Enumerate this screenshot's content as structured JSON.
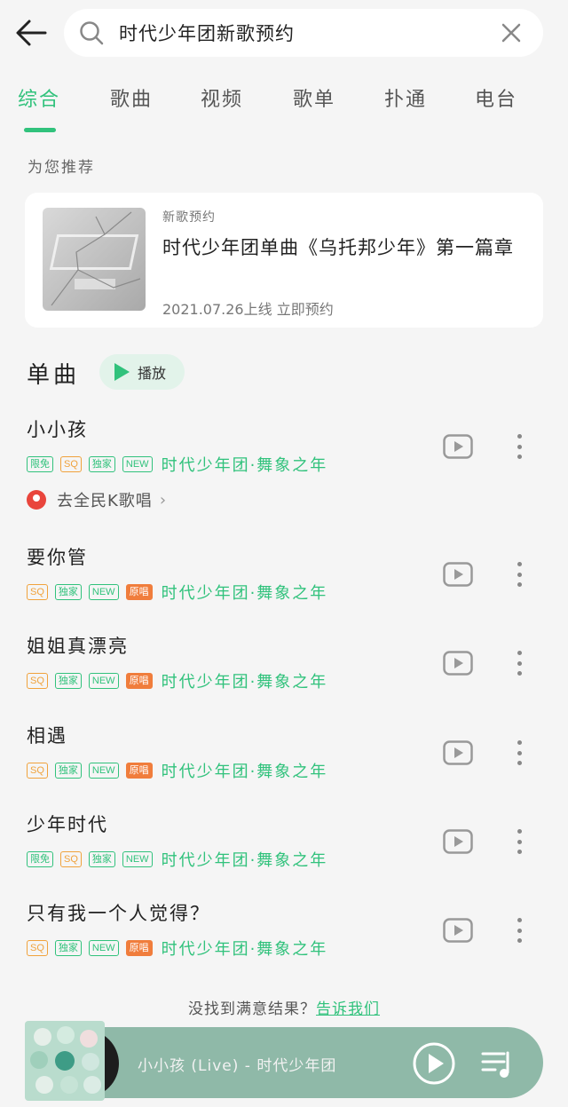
{
  "search": {
    "query": "时代少年团新歌预约"
  },
  "tabs": [
    {
      "label": "综合",
      "active": true
    },
    {
      "label": "歌曲"
    },
    {
      "label": "视频"
    },
    {
      "label": "歌单"
    },
    {
      "label": "扑通"
    },
    {
      "label": "电台"
    }
  ],
  "recommend": {
    "section_label": "为您推荐",
    "tag": "新歌预约",
    "title": "时代少年团单曲《乌托邦少年》第一篇章",
    "subtitle": "2021.07.26上线 立即预约"
  },
  "singles": {
    "title": "单曲",
    "play_all_label": "播放",
    "ksong_link": "去全民K歌唱",
    "songs": [
      {
        "title": "小小孩",
        "badges": [
          "限免",
          "SQ",
          "独家",
          "NEW"
        ],
        "artist": "时代少年团·舞象之年"
      },
      {
        "title": "要你管",
        "badges": [
          "SQ",
          "独家",
          "NEW",
          "原唱"
        ],
        "artist": "时代少年团·舞象之年"
      },
      {
        "title": "姐姐真漂亮",
        "badges": [
          "SQ",
          "独家",
          "NEW",
          "原唱"
        ],
        "artist": "时代少年团·舞象之年"
      },
      {
        "title": "相遇",
        "badges": [
          "SQ",
          "独家",
          "NEW",
          "原唱"
        ],
        "artist": "时代少年团·舞象之年"
      },
      {
        "title": "少年时代",
        "badges": [
          "限免",
          "SQ",
          "独家",
          "NEW"
        ],
        "artist": "时代少年团·舞象之年"
      },
      {
        "title": "只有我一个人觉得？",
        "badges": [
          "SQ",
          "独家",
          "NEW",
          "原唱"
        ],
        "artist": "时代少年团·舞象之年"
      }
    ]
  },
  "feedback": {
    "text": "没找到满意结果？",
    "link": "告诉我们"
  },
  "player": {
    "now_playing": "小小孩 (Live) - 时代少年团"
  },
  "colors": {
    "accent": "#31c27c",
    "badge_orange": "#f0a23c",
    "badge_fill": "#f07d3c",
    "player_bg": "#8fb9a8"
  },
  "icons": [
    "back-arrow-icon",
    "search-icon",
    "close-icon",
    "play-icon",
    "mv-play-icon",
    "more-icon",
    "ksong-icon",
    "chevron-right-icon",
    "playlist-icon"
  ]
}
